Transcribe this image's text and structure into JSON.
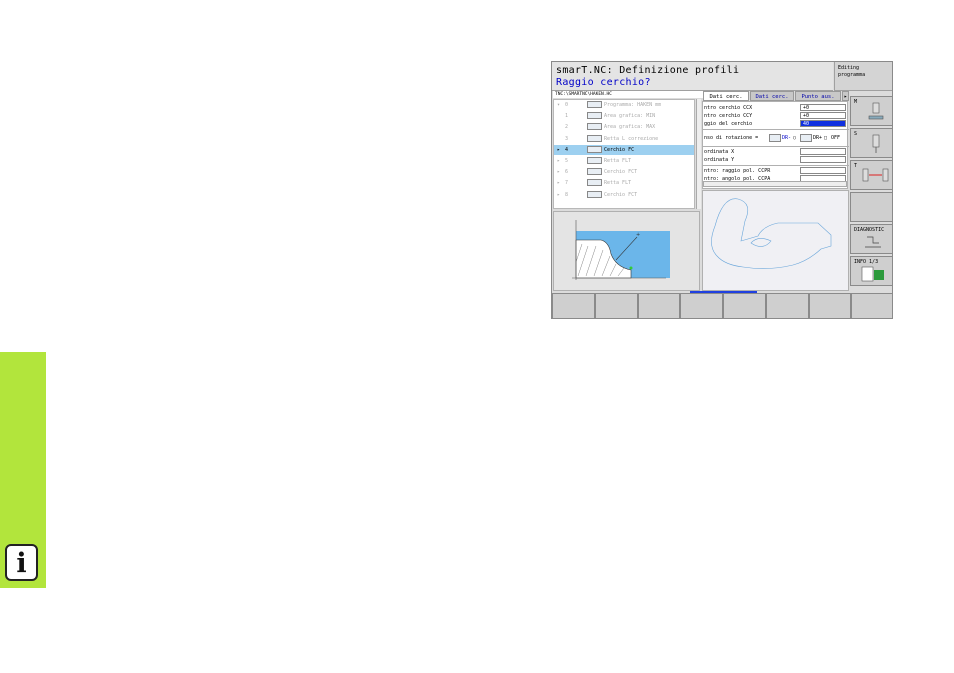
{
  "title": {
    "line1": "smarT.NC: Definizione profili",
    "line2": "Raggio cerchio?"
  },
  "mode": {
    "line1": "Editing",
    "line2": "programma"
  },
  "path": "TNC:\\SMARTNC\\HAKEN.HC",
  "tree": [
    {
      "arrow": "▾",
      "num": "0",
      "label": "Programma: HAKEN mm",
      "selected": false
    },
    {
      "arrow": "",
      "num": "1",
      "label": "Area grafica: MIN",
      "selected": false
    },
    {
      "arrow": "",
      "num": "2",
      "label": "Area grafica: MAX",
      "selected": false
    },
    {
      "arrow": "",
      "num": "3",
      "label": "Retta L correzione",
      "selected": false
    },
    {
      "arrow": "▸",
      "num": "4",
      "label": "Cerchio FC",
      "selected": true
    },
    {
      "arrow": "▸",
      "num": "5",
      "label": "Retta FLT",
      "selected": false
    },
    {
      "arrow": "▸",
      "num": "6",
      "label": "Cerchio FCT",
      "selected": false
    },
    {
      "arrow": "▸",
      "num": "7",
      "label": "Retta FLT",
      "selected": false
    },
    {
      "arrow": "▸",
      "num": "8",
      "label": "Cerchio FCT",
      "selected": false
    }
  ],
  "tabs": [
    "Dati cerc.",
    "Dati cerc.",
    "Punto aus."
  ],
  "form": {
    "ccx_label": "ntro cerchio CCX",
    "ccx_value": "+0",
    "ccy_label": "ntro cerchio CCY",
    "ccy_value": "+0",
    "radius_label": "ggio del cerchio",
    "radius_value": "40",
    "rot_label": "nso di rotazione =",
    "dr_minus": "DR-",
    "dr_plus": "DR+",
    "off": "OFF",
    "x_label": "ordinata X",
    "x_value": "",
    "y_label": "ordinata Y",
    "y_value": "",
    "ccpr_label": "ntro: raggio pol. CCPR",
    "ccpr_value": "",
    "ccpa_label": "ntro: angolo pol. CCPA",
    "ccpa_value": ""
  },
  "side_buttons": [
    {
      "label": "M",
      "icon": "spindle-icon"
    },
    {
      "label": "S",
      "icon": "tool-icon"
    },
    {
      "label": "T",
      "icon": "tool-change-icon"
    },
    {
      "label": "",
      "icon": ""
    },
    {
      "label": "DIAGNOSTIC",
      "icon": "diagnostic-icon"
    },
    {
      "label": "INFO 1/3",
      "icon": "info-icon"
    }
  ],
  "colors": {
    "accent": "#b2e53c",
    "selection": "#9dd0f0",
    "highlight": "#1030e0",
    "title_blue": "#0000c8"
  }
}
